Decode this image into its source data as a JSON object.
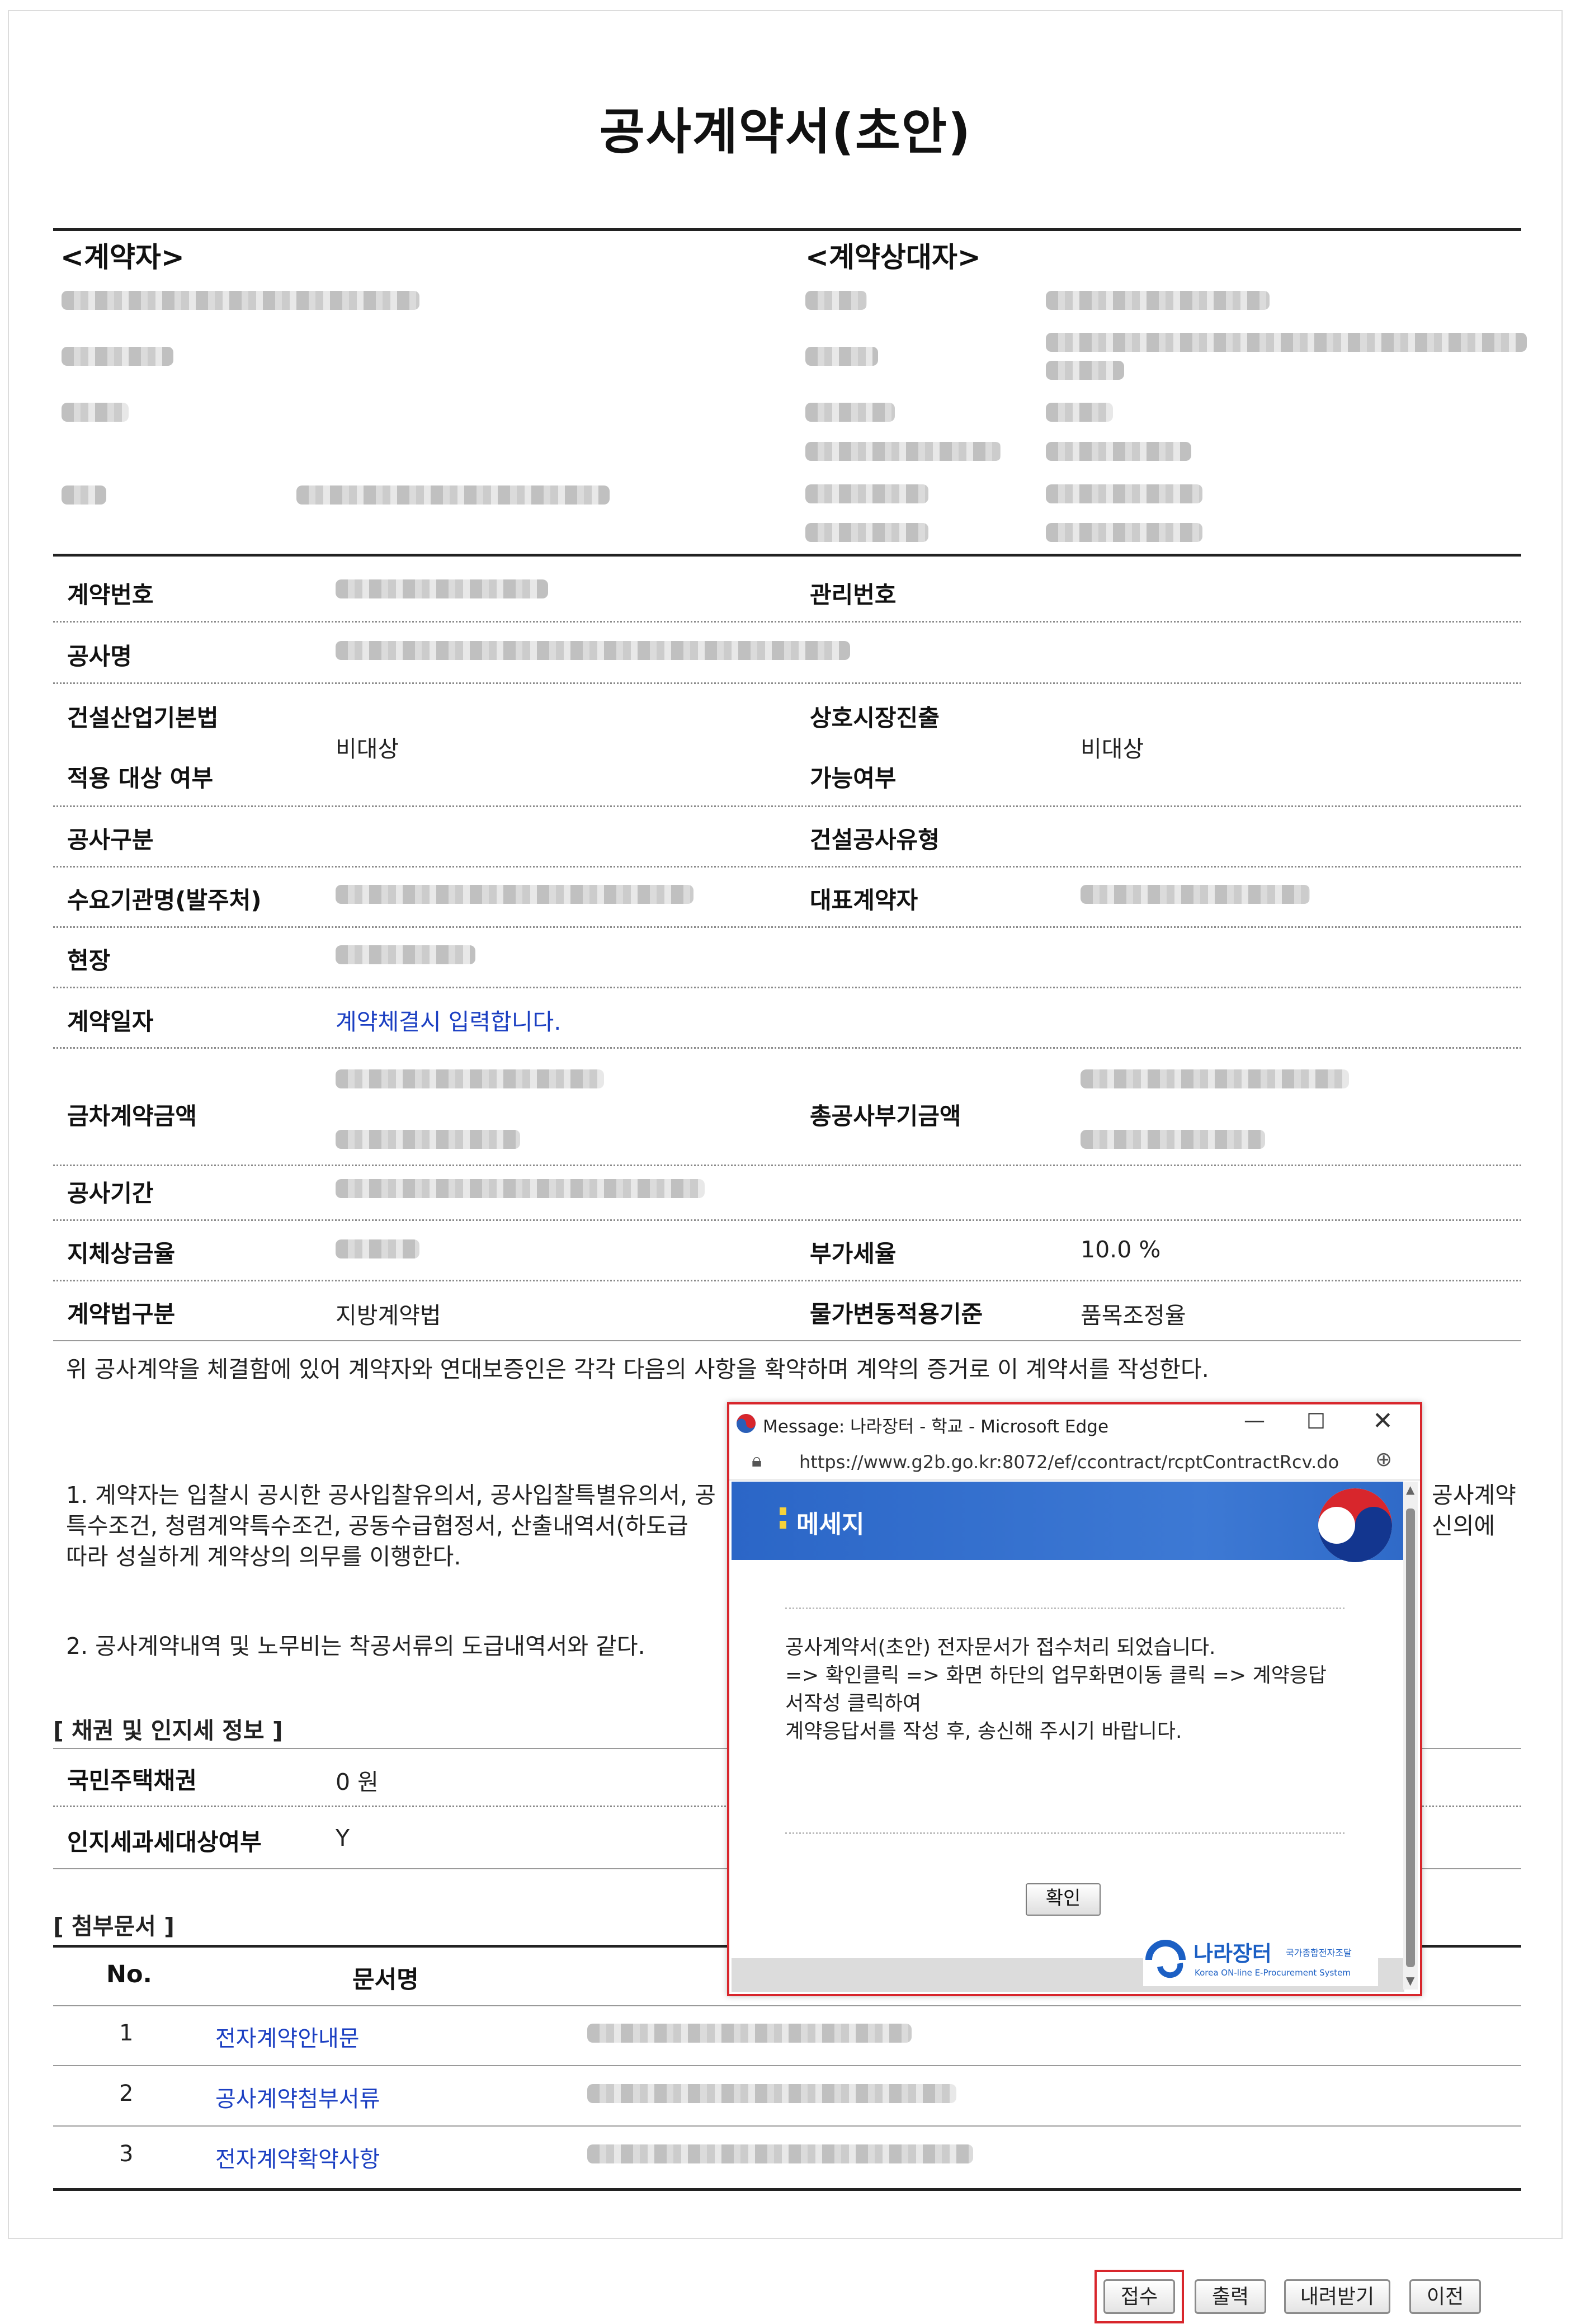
{
  "document": {
    "title": "공사계약서(초안)",
    "contractor_header": "<계약자>",
    "counterparty_header": "<계약상대자>",
    "fields": {
      "contract_no": "계약번호",
      "mgmt_no": "관리번호",
      "project_name": "공사명",
      "basic_act_1": "건설산업기본법",
      "basic_act_2": "적용 대상 여부",
      "basic_act_value": "비대상",
      "mutual_1": "상호시장진출",
      "mutual_2": "가능여부",
      "mutual_value": "비대상",
      "work_type": "공사구분",
      "construction_type": "건설공사유형",
      "client": "수요기관명(발주처)",
      "rep_contract": "대표계약자",
      "site": "현장",
      "contract_date": "계약일자",
      "contract_date_value": "계약체결시 입력합니다.",
      "amount": "금차계약금액",
      "total_amount": "총공사부기금액",
      "period": "공사기간",
      "delay_rate": "지체상금율",
      "vat_rate": "부가세율",
      "vat_value": "10.0 %",
      "law": "계약법구분",
      "law_value": "지방계약법",
      "price_adj": "물가변동적용기준",
      "price_adj_value": "품목조정율"
    },
    "intro": "위 공사계약을 체결함에 있어 계약자와 연대보증인은 각각 다음의 사항을 확약하며 계약의 증거로 이 계약서를 작성한다.",
    "clause1_a": "1. 계약자는 입찰시 공시한 공사입찰유의서, 공사입찰특별유의서, 공",
    "clause1_a_right": "공사계약",
    "clause1_b": "특수조건, 청렴계약특수조건, 공동수급협정서, 산출내역서(하도급",
    "clause1_b_right": "신의에",
    "clause1_c": "따라 성실하게 계약상의 의무를 이행한다.",
    "clause2": "2. 공사계약내역 및 노무비는 착공서류의 도급내역서와 같다.",
    "bond_section": "[ 채권 및 인지세 정보 ]",
    "bond_label": "국민주택채권",
    "bond_value": "0 원",
    "stamp_label": "인지세과세대상여부",
    "stamp_value": "Y",
    "attach_section": "[ 첨부문서 ]",
    "attach_col_no": "No.",
    "attach_col_name": "문서명",
    "attachments": [
      {
        "no": "1",
        "name": "전자계약안내문"
      },
      {
        "no": "2",
        "name": "공사계약첨부서류"
      },
      {
        "no": "3",
        "name": "전자계약확약사항"
      }
    ]
  },
  "buttons": {
    "receive": "접수",
    "print": "출력",
    "download": "내려받기",
    "prev": "이전"
  },
  "popup": {
    "window_title": "Message: 나라장터 - 학교 - Microsoft Edge",
    "url": "https://www.g2b.go.kr:8072/ef/ccontract/rcptContractRcv.do",
    "header": "메세지",
    "line1": "공사계약서(초안) 전자문서가 접수처리 되었습니다.",
    "line2": "=> 확인클릭 => 화면 하단의 업무화면이동 클릭 => 계약응답",
    "line3": "서작성 클릭하여",
    "line4": "계약응답서를 작성 후, 송신해 주시기 바랍니다.",
    "ok": "확인",
    "logo_main": "나라장터",
    "logo_sub1": "국가종합전자조달",
    "logo_sub2": "Korea ON-line E-Procurement System"
  },
  "colors": {
    "highlight": "#d8262c",
    "link": "#1b3fc2",
    "popup_header": "#2b66c7"
  }
}
